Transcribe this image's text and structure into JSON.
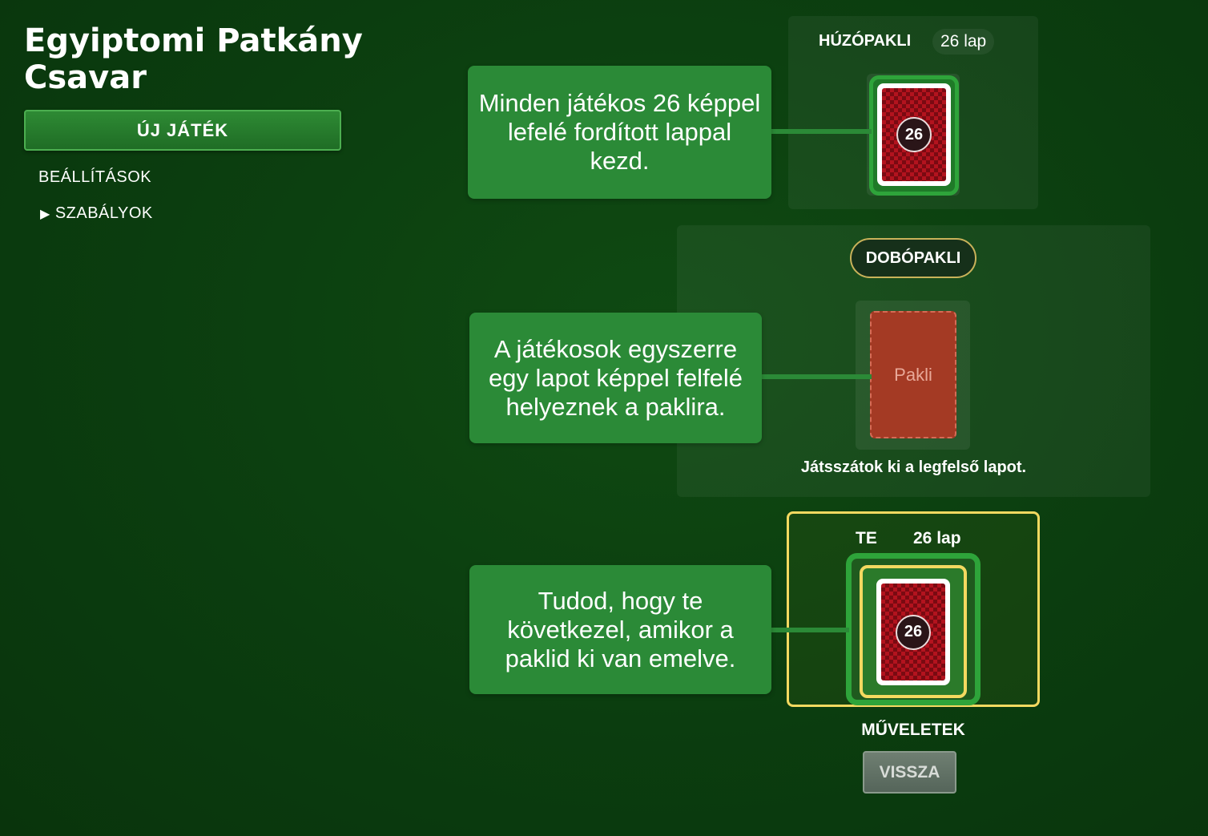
{
  "title": "Egyiptomi Patkány Csavar",
  "menu": {
    "new_game": "ÚJ JÁTÉK",
    "settings": "BEÁLLÍTÁSOK",
    "rules": "SZABÁLYOK",
    "rules_icon": "triangle-right-icon"
  },
  "draw_pile": {
    "label": "HÚZÓPAKLI",
    "count": "26 lap",
    "card_badge": "26"
  },
  "discard_pile": {
    "label": "DOBÓPAKLI",
    "placeholder": "Pakli",
    "instruction": "Játsszátok ki a legfelső lapot."
  },
  "player": {
    "label": "TE",
    "count": "26 lap",
    "card_badge": "26"
  },
  "actions": {
    "label": "MŰVELETEK",
    "back": "VISSZA"
  },
  "callouts": {
    "deal": "Minden játékos 26 képpel lefelé fordított lappal kezd.",
    "play": "A játékosok egyszerre egy lapot képpel felfelé helyeznek a paklira.",
    "turn": "Tudod, hogy te következel, amikor a paklid ki van emelve."
  },
  "colors": {
    "background": "#0b3d0f",
    "accent_green": "#2b8a37",
    "highlight_yellow": "#f4d960",
    "card_red": "#b3131e"
  }
}
